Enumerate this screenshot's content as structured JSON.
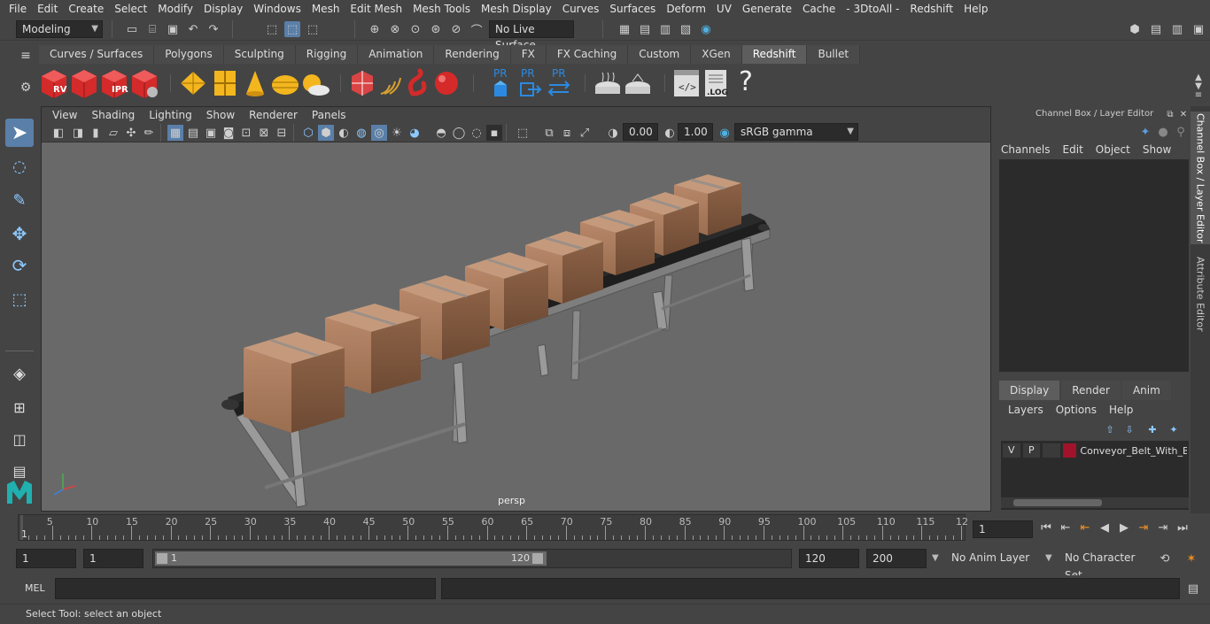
{
  "menubar": [
    "File",
    "Edit",
    "Create",
    "Select",
    "Modify",
    "Display",
    "Windows",
    "Mesh",
    "Edit Mesh",
    "Mesh Tools",
    "Mesh Display",
    "Curves",
    "Surfaces",
    "Deform",
    "UV",
    "Generate",
    "Cache",
    "- 3DtoAll -",
    "Redshift",
    "Help"
  ],
  "status": {
    "mode": "Modeling",
    "live_surface": "No Live Surface"
  },
  "shelf": {
    "tabs": [
      "Curves / Surfaces",
      "Polygons",
      "Sculpting",
      "Rigging",
      "Animation",
      "Rendering",
      "FX",
      "FX Caching",
      "Custom",
      "XGen",
      "Redshift",
      "Bullet"
    ],
    "active_tab": "Redshift",
    "labels": {
      "rv": "RV",
      "ipr": "IPR",
      "pr": "PR",
      "log": ".LOG",
      "help": "?"
    }
  },
  "viewport": {
    "menu": [
      "View",
      "Shading",
      "Lighting",
      "Show",
      "Renderer",
      "Panels"
    ],
    "exposure": "0.00",
    "gamma": "1.00",
    "colorspace": "sRGB gamma",
    "camera_label": "persp"
  },
  "channel_box": {
    "title": "Channel Box / Layer Editor",
    "menu": [
      "Channels",
      "Edit",
      "Object",
      "Show"
    ],
    "layer_tabs": [
      "Display",
      "Render",
      "Anim"
    ],
    "layer_menu": [
      "Layers",
      "Options",
      "Help"
    ],
    "layer": {
      "v": "V",
      "p": "P",
      "name": "Conveyor_Belt_With_B",
      "color": "#a0132a"
    }
  },
  "right_tabs": [
    "Channel Box / Layer Editor",
    "Attribute Editor"
  ],
  "timeline": {
    "ticks": [
      "5",
      "10",
      "15",
      "20",
      "25",
      "30",
      "35",
      "40",
      "45",
      "50",
      "55",
      "60",
      "65",
      "70",
      "75",
      "80",
      "85",
      "90",
      "95",
      "100",
      "105",
      "110",
      "115",
      "12"
    ],
    "start_label": "1",
    "current_frame": "1"
  },
  "range": {
    "start": "1",
    "playback_start": "1",
    "slider_start": "1",
    "slider_end": "120",
    "playback_end": "120",
    "end": "200",
    "anim_layer": "No Anim Layer",
    "character_set": "No Character Set"
  },
  "command": {
    "language": "MEL"
  },
  "helpline": "Select Tool: select an object",
  "colors": {
    "accent_active_tab": "#5d5d5d",
    "redshift_red": "#d42a2a",
    "layer_color": "#a0132a",
    "tool_highlight": "#5a7fa8"
  }
}
